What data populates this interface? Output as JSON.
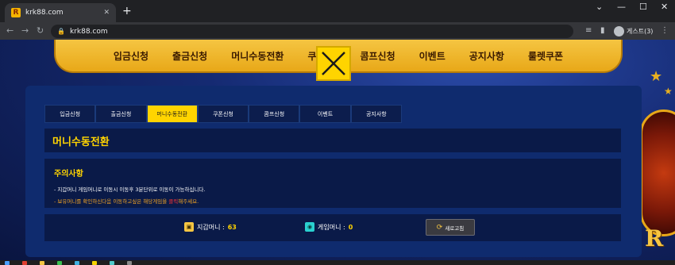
{
  "browser": {
    "tab_title": "krk88.com",
    "tab_close": "✕",
    "new_tab": "+",
    "url": "krk88.com",
    "profile_label": "게스트(3)",
    "favicon_letter": "R"
  },
  "topnav": {
    "items": [
      "입금신청",
      "출금신청",
      "머니수동전환",
      "쿠",
      "콤프신청",
      "이벤트",
      "공지사항",
      "룰렛쿠폰"
    ]
  },
  "subtabs": [
    "입금신청",
    "출금신청",
    "머니수동전환",
    "쿠폰신청",
    "콤프신청",
    "이벤트",
    "공지사항"
  ],
  "active_subtab": "머니수동전환",
  "page_title": "머니수동전환",
  "notice": {
    "title": "주의사항",
    "line1": "- 지갑머니 게임머니로 이동시 이동후 3분단위로 이동이 가능하십니다.",
    "line2_pre": "- 보유머니를 확인하신다음 이동하고싶은 해당게임을 ",
    "line2_red": "클릭",
    "line2_post": "해주세요."
  },
  "balance": {
    "wallet_label": "지갑머니 :",
    "wallet_value": "63",
    "game_label": "게임머니 :",
    "game_value": "0",
    "refresh_label": "새로고침"
  },
  "colors": {
    "accent": "#ffd400",
    "panel": "#0f2b6e",
    "nav_gold": "#f5c542"
  }
}
